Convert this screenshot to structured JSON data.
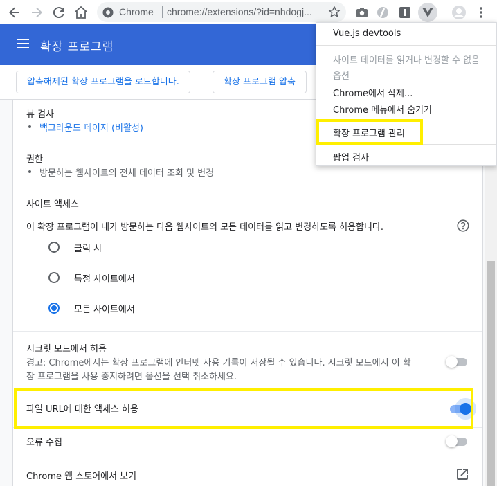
{
  "toolbar": {
    "omnibox_site": "Chrome",
    "omnibox_url": "chrome://extensions/?id=nhdogj..."
  },
  "header": {
    "title": "확장 프로그램"
  },
  "subbar": {
    "load_unpacked": "압축해제된 확장 프로그램을 로드합니다.",
    "pack": "확장 프로그램 압축"
  },
  "details": {
    "inspect_views_title": "뷰 검사",
    "inspect_views_link": "백그라운드 페이지 (비활성)",
    "permissions_title": "권한",
    "permissions_item": "방문하는 웹사이트의 전체 데이터 조회 및 변경",
    "site_access_title": "사이트 액세스",
    "site_access_desc": "이 확장 프로그램이 내가 방문하는 다음 웹사이트의 모든 데이터를 읽고 변경하도록 허용합니다.",
    "site_access_options": [
      "클릭 시",
      "특정 사이트에서",
      "모든 사이트에서"
    ],
    "site_access_selected": "모든 사이트에서",
    "incognito_title": "시크릿 모드에서 허용",
    "incognito_desc_1": "경고: Chrome에서는 확장 프로그램에 인터넷 사용 기록이 저장될 수 있습니다. 시크릿 모드에서 이 확",
    "incognito_desc_2": "장 프로그램을 사용 중지하려면 옵션을 선택 취소하세요.",
    "incognito_enabled": false,
    "file_url_title": "파일 URL에 대한 액세스 허용",
    "file_url_enabled": true,
    "errors_title": "오류 수집",
    "errors_enabled": false,
    "webstore_title": "Chrome 웹 스토어에서 보기"
  },
  "context_menu": {
    "title": "Vue.js devtools",
    "disabled_1": "사이트 데이터를 읽거나 변경할 수 없음",
    "options": "옵션",
    "remove": "Chrome에서 삭제...",
    "hide": "Chrome 메뉴에서 숨기기",
    "manage": "확장 프로그램 관리",
    "inspect_popup": "팝업 검사"
  },
  "colors": {
    "header_bg": "#3367d6",
    "accent": "#1a73e8",
    "highlight": "#ffef00"
  }
}
